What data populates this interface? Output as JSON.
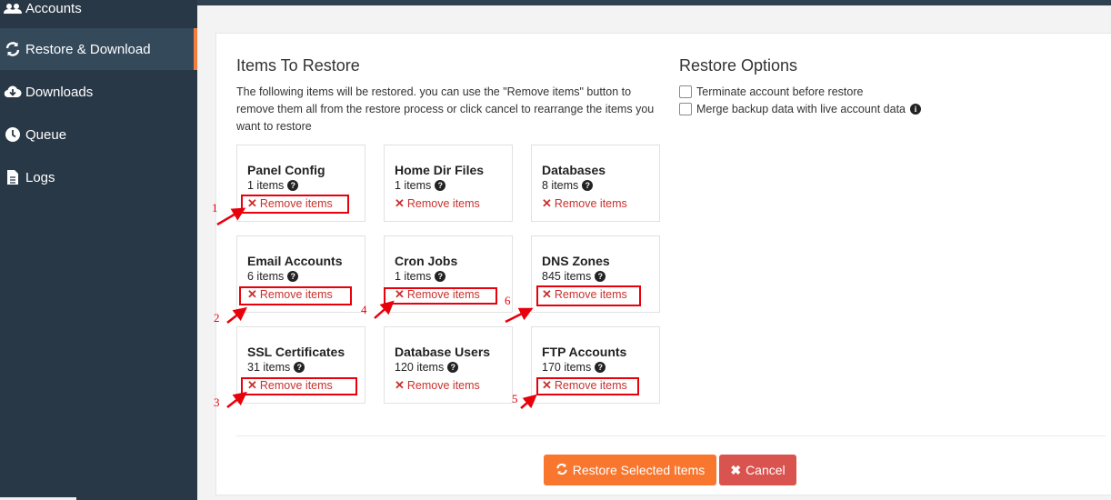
{
  "sidebar": {
    "items": [
      {
        "label": "Accounts",
        "icon": "users-icon"
      },
      {
        "label": "Restore & Download",
        "icon": "refresh-icon",
        "active": true
      },
      {
        "label": "Downloads",
        "icon": "cloud-download-icon"
      },
      {
        "label": "Queue",
        "icon": "clock-icon"
      },
      {
        "label": "Logs",
        "icon": "file-icon"
      }
    ]
  },
  "restore": {
    "title": "Items To Restore",
    "description": "The following items will be restored. you can use the \"Remove items\" button to remove them all from the restore process or click cancel to rearrange the items you want to restore",
    "remove_label": "Remove items",
    "cards": [
      {
        "title": "Panel Config",
        "count": "1 items"
      },
      {
        "title": "Home Dir Files",
        "count": "1 items"
      },
      {
        "title": "Databases",
        "count": "8 items"
      },
      {
        "title": "Email Accounts",
        "count": "6 items"
      },
      {
        "title": "Cron Jobs",
        "count": "1 items"
      },
      {
        "title": "DNS Zones",
        "count": "845 items"
      },
      {
        "title": "SSL Certificates",
        "count": "31 items"
      },
      {
        "title": "Database Users",
        "count": "120 items"
      },
      {
        "title": "FTP Accounts",
        "count": "170 items"
      }
    ]
  },
  "options": {
    "title": "Restore Options",
    "items": [
      {
        "label": "Terminate account before restore",
        "checked": false
      },
      {
        "label": "Merge backup data with live account data",
        "checked": false
      }
    ]
  },
  "buttons": {
    "restore_label": "Restore Selected Items",
    "cancel_label": "Cancel"
  },
  "annotations": {
    "numbers": [
      "1",
      "2",
      "3",
      "4",
      "5",
      "6"
    ],
    "color": "#e8000b"
  },
  "colors": {
    "sidebar_bg": "#293846",
    "accent_orange": "#f8762e",
    "danger_red": "#d9534f"
  }
}
